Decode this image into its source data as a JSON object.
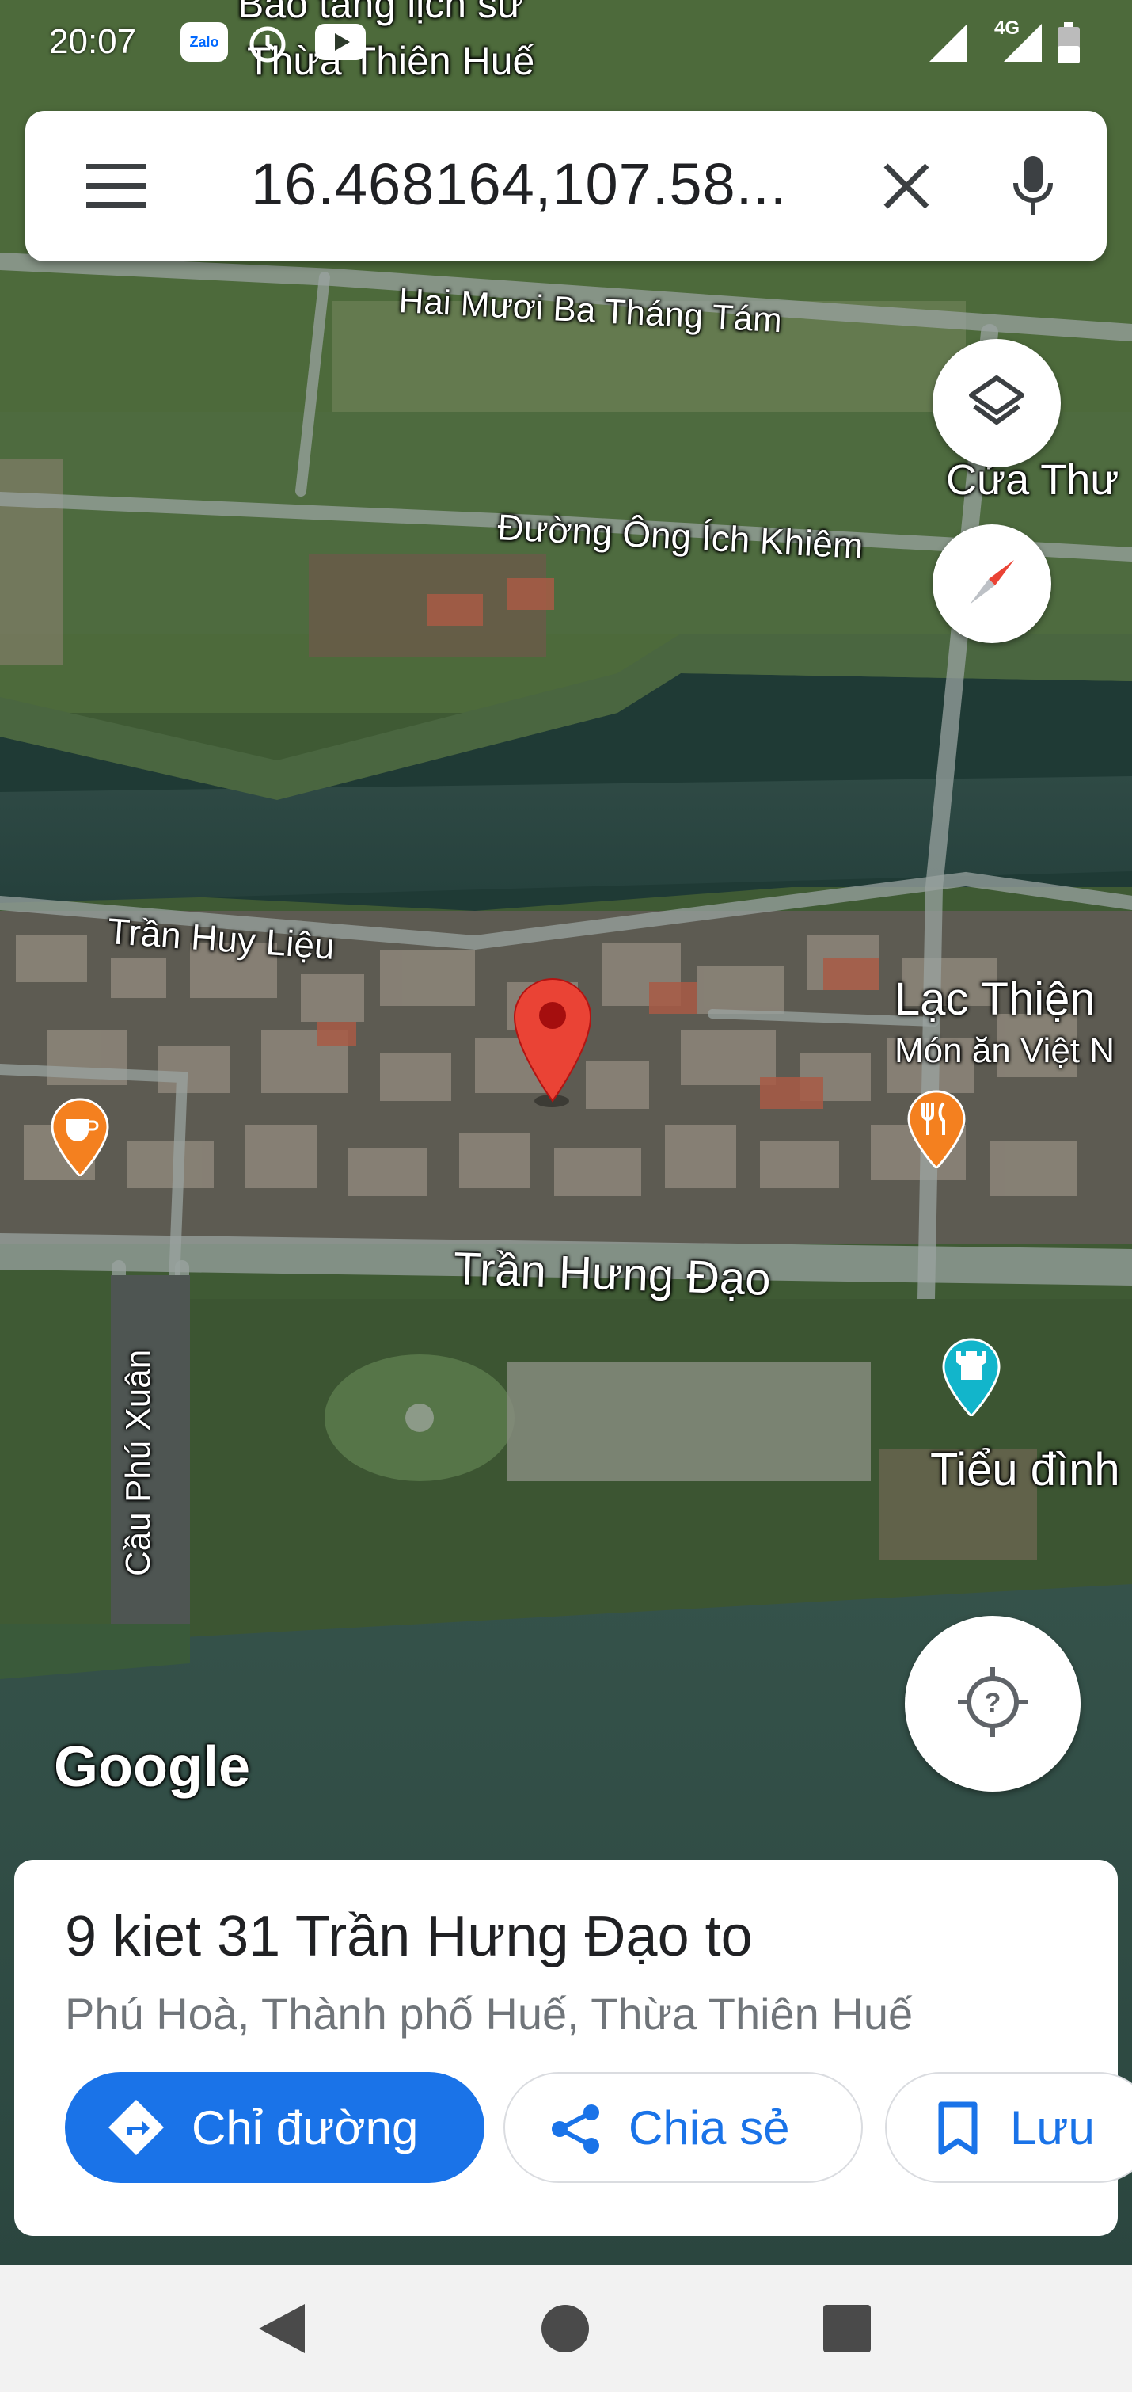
{
  "status_bar": {
    "time": "20:07",
    "network_label": "4G",
    "icons": [
      "zalo-icon",
      "alarm-icon",
      "youtube-icon",
      "signal-icon",
      "battery-icon"
    ]
  },
  "search_bar": {
    "query": "16.468164,107.58...",
    "menu_icon": "hamburger-menu-icon",
    "clear_icon": "close-icon",
    "voice_icon": "microphone-icon"
  },
  "map": {
    "labels": [
      {
        "text": "Bảo tàng lịch sử"
      },
      {
        "text": "Thừa Thiên Huế"
      },
      {
        "text": "Hai Mươi Ba Tháng Tám"
      },
      {
        "text": "Cửa Thư"
      },
      {
        "text": "Đường Ông Ích Khiêm"
      },
      {
        "text": "Trần Huy Liệu"
      },
      {
        "text": "Lạc Thiện"
      },
      {
        "text": "Món ăn Việt N"
      },
      {
        "text": "Trần Hưng Đạo"
      },
      {
        "text": "Cầu Phú Xuân"
      },
      {
        "text": "Tiểu đình"
      }
    ],
    "watermark": "Google",
    "layers_icon": "layers-icon",
    "compass_icon": "compass-icon",
    "location_icon": "my-location-icon",
    "pin_color": "#ea4335"
  },
  "place_card": {
    "title": "9 kiet 31 Trần Hưng Đạo to",
    "address": "Phú Hoà, Thành phố Huế, Thừa Thiên Huế",
    "actions": {
      "directions": "Chỉ đường",
      "share": "Chia sẻ",
      "save": "Lưu"
    }
  },
  "nav_bar": {
    "icons": [
      "back-icon",
      "home-icon",
      "recents-icon"
    ]
  },
  "colors": {
    "accent": "#1a73e8",
    "pin": "#ea4335",
    "poi_food": "#f4801f",
    "poi_attraction": "#12b5cb"
  }
}
